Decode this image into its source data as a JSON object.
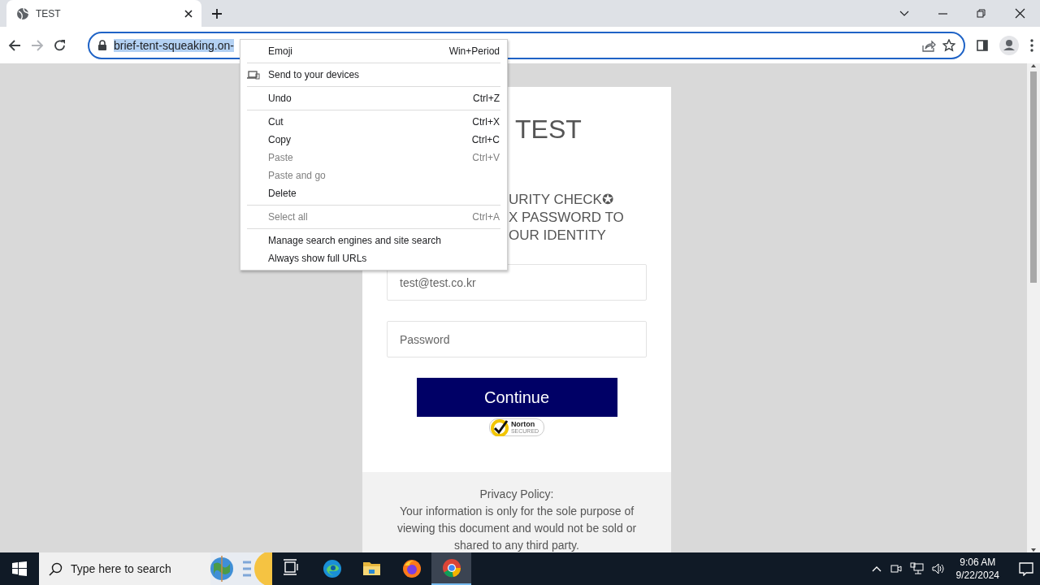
{
  "browser": {
    "tabs": [
      {
        "title": "TEST",
        "selected": true
      }
    ],
    "address": {
      "url": "brief-tent-squeaking.on-",
      "selected": true
    }
  },
  "page": {
    "heading": "TEST",
    "notice_lines": [
      "URITY CHECK✪",
      "X PASSWORD TO",
      "OUR IDENTITY"
    ],
    "email_field": {
      "value": "test@test.co.kr"
    },
    "password_field": {
      "placeholder": "Password"
    },
    "continue_button": "Continue",
    "seal": {
      "brand": "Norton",
      "caption": "SECURED"
    },
    "footer": {
      "title": "Privacy Policy:",
      "lines": [
        "Your information is only for the sole purpose of",
        "viewing this document and would not be sold or",
        "shared to any third party."
      ]
    }
  },
  "context_menu": {
    "sections": [
      [
        {
          "label": "Emoji",
          "shortcut": "Win+Period",
          "disabled": false,
          "kind": "plain"
        }
      ],
      [
        {
          "label": "Send to your devices",
          "disabled": false,
          "kind": "device"
        }
      ],
      [
        {
          "label": "Undo",
          "shortcut": "Ctrl+Z",
          "disabled": false,
          "kind": "plain"
        }
      ],
      [
        {
          "label": "Cut",
          "shortcut": "Ctrl+X",
          "disabled": false,
          "kind": "plain"
        },
        {
          "label": "Copy",
          "shortcut": "Ctrl+C",
          "disabled": false,
          "kind": "plain"
        },
        {
          "label": "Paste",
          "shortcut": "Ctrl+V",
          "disabled": true,
          "kind": "plain"
        },
        {
          "label": "Paste and go",
          "disabled": true,
          "kind": "plain"
        },
        {
          "label": "Delete",
          "disabled": false,
          "kind": "plain"
        }
      ],
      [
        {
          "label": "Select all",
          "shortcut": "Ctrl+A",
          "disabled": true,
          "kind": "plain"
        }
      ],
      [
        {
          "label": "Manage search engines and site search",
          "disabled": false,
          "kind": "plain"
        },
        {
          "label": "Always show full URLs",
          "disabled": false,
          "kind": "plain"
        }
      ]
    ]
  },
  "taskbar": {
    "search_placeholder": "Type here to search",
    "apps": [
      {
        "kind": "taskview",
        "selected": false
      },
      {
        "kind": "edge",
        "selected": false
      },
      {
        "kind": "files",
        "selected": false
      },
      {
        "kind": "firefox",
        "selected": false
      },
      {
        "kind": "chrome",
        "selected": true
      }
    ],
    "time": "9:06 AM",
    "date": "9/22/2024"
  }
}
